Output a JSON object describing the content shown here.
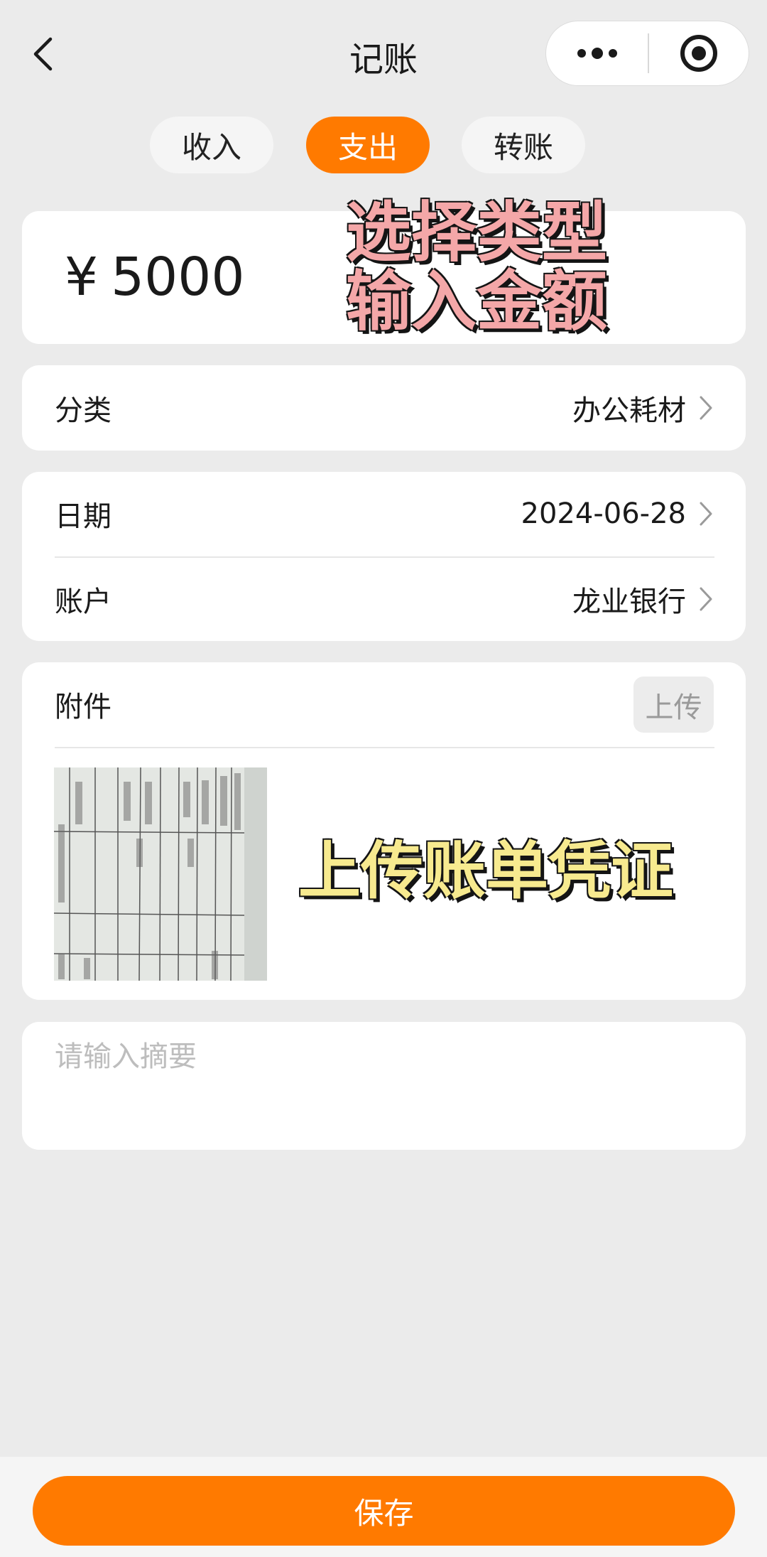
{
  "header": {
    "title": "记账"
  },
  "tabs": [
    {
      "label": "收入"
    },
    {
      "label": "支出",
      "active": true
    },
    {
      "label": "转账"
    }
  ],
  "amount": {
    "currency": "¥",
    "value": "5000"
  },
  "overlays": {
    "type_hint_line1": "选择类型",
    "type_hint_line2": "输入金额",
    "upload_hint": "上传账单凭证"
  },
  "category": {
    "label": "分类",
    "value": "办公耗材"
  },
  "date": {
    "label": "日期",
    "value": "2024-06-28"
  },
  "account": {
    "label": "账户",
    "value": "龙业银行"
  },
  "attachment": {
    "label": "附件",
    "upload_label": "上传"
  },
  "summary": {
    "placeholder": "请输入摘要",
    "value": ""
  },
  "save": {
    "label": "保存"
  },
  "colors": {
    "accent": "#ff7a00",
    "background": "#ebebeb",
    "card": "#ffffff"
  },
  "icons": [
    "back-arrow-icon",
    "more-dots-icon",
    "target-circle-icon",
    "chevron-right-icon"
  ]
}
